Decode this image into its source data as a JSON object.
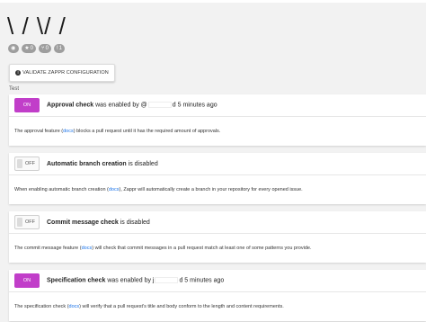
{
  "header": {
    "title": "\\ / \\/ /"
  },
  "badges": [
    {
      "icon": "eye-icon",
      "count": ""
    },
    {
      "icon": "star-icon",
      "count": "0"
    },
    {
      "icon": "fork-icon",
      "count": "0"
    },
    {
      "icon": "issue-icon",
      "count": "1"
    }
  ],
  "validate_button": {
    "label": "VALIDATE ZAPPR CONFIGURATION"
  },
  "section_label": "Test",
  "checks": [
    {
      "state": "ON",
      "name": "Approval check",
      "status_prefix": "was enabled by @",
      "status_suffix": "d 5 minutes ago",
      "desc_before": "The approval feature (",
      "desc_link": "docs",
      "desc_after": ") blocks a pull request until it has the required amount of approvals."
    },
    {
      "state": "OFF",
      "name": "Automatic branch creation",
      "status_prefix": "is disabled",
      "status_suffix": "",
      "desc_before": "When enabling automatic branch creation (",
      "desc_link": "docs",
      "desc_after": "), Zappr will automatically create a branch in your repository for every opened issue."
    },
    {
      "state": "OFF",
      "name": "Commit message check",
      "status_prefix": "is disabled",
      "status_suffix": "",
      "desc_before": "The commit message feature (",
      "desc_link": "docs",
      "desc_after": ") will check that commit messages in a pull request match at least one of some patterns you provide."
    },
    {
      "state": "ON",
      "name": "Specification check",
      "status_prefix": "was enabled by j",
      "status_suffix": "d 5 minutes ago",
      "desc_before": "The specification check (",
      "desc_link": "docs",
      "desc_after": ") will verify that a pull request's title and body conform to the length and content requirements."
    }
  ],
  "colors": {
    "toggle_on": "#c13ec9",
    "link": "#1a73e8",
    "page_bg": "#f2f2f2"
  }
}
